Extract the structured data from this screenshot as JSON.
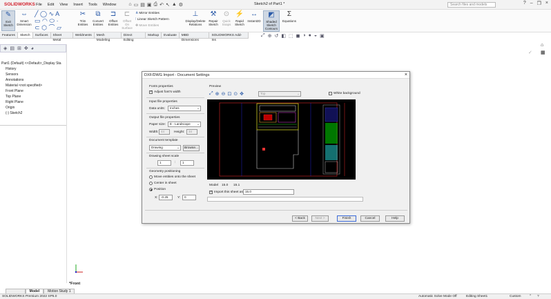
{
  "app": {
    "logo": "SOLIDWORKS",
    "title": "Sketch2 of Part1 *",
    "search_placeholder": "Search files and models"
  },
  "menu": [
    "File",
    "Edit",
    "View",
    "Insert",
    "Tools",
    "Window"
  ],
  "ribbon": {
    "exit_sketch": "Exit Sketch",
    "smart_dimension": "Smart Dimension",
    "trim": "Trim Entities",
    "convert": "Convert Entities",
    "offset": "Offset Entities",
    "offset_surface": "Offset On Surface",
    "mirror": "Mirror Entities",
    "linear_pattern": "Linear Sketch Pattern",
    "move": "Move Entities",
    "display_delete": "Display/Delete Relations",
    "repair": "Repair Sketch",
    "quick_snaps": "Quick Snaps",
    "rapid_sketch": "Rapid Sketch",
    "instant2d": "Instant2D",
    "shaded_contours": "Shaded Sketch Contours",
    "equations": "Equations"
  },
  "tabs": [
    "Features",
    "Sketch",
    "Surfaces",
    "Sheet Metal",
    "Weldments",
    "Mesh Modeling",
    "Direct Editing",
    "Markup",
    "Evaluate",
    "MBD Dimensions",
    "SOLIDWORKS Add-Ins"
  ],
  "tree": {
    "root": "Part1 (Default) <<Default>_Display Sta",
    "items": [
      "History",
      "Sensors",
      "Annotations",
      "Material <not specified>",
      "Front Plane",
      "Top Plane",
      "Right Plane",
      "Origin",
      "(-) Sketch2"
    ]
  },
  "dialog": {
    "title": "DXF/DWG Import - Document Settings",
    "fonts_group": "Fonts properties",
    "adjust_font": "Adjust font's width",
    "input_group": "Input file properties",
    "data_units_label": "Data units:",
    "data_units_value": "Inches",
    "output_group": "Output file properties",
    "paper_size_label": "Paper size:",
    "paper_size_value": "E - Landscape",
    "width_label": "Width:",
    "width_value": "44",
    "height_label": "Height:",
    "height_value": "34",
    "template_group": "Document template",
    "template_value": "Drawing",
    "browse": "Browse...",
    "scale_group": "Drawing sheet scale",
    "scale_left": "1",
    "scale_sep": ":",
    "scale_right": "1",
    "geometry_group": "Geometry positioning",
    "move_entities": "Move entities onto the sheet",
    "center_sheet": "Center in sheet",
    "position": "Position",
    "x_label": "X:",
    "x_value": "-0.25",
    "y_label": "Y:",
    "y_value": "0",
    "preview_group": "Preview",
    "view_select": "Top",
    "white_bg": "White background",
    "model_label": "Model",
    "model_a": "15.0",
    "model_b": "15.1",
    "import_sheet": "Import this sheet as",
    "import_value": "15.0",
    "back": "< Back",
    "next": "Next >",
    "finish": "Finish",
    "cancel": "Cancel",
    "help": "Help"
  },
  "footer_tabs": [
    "",
    "Model",
    "Motion Study 1"
  ],
  "view_label": "*Front",
  "status": {
    "version": "SOLIDWORKS Premium 2022 SP5.0",
    "solve": "Automatic Solve Mode Off",
    "editing": "Editing Sheet1",
    "units": "Custom"
  },
  "colors": {
    "brand": "#d21f2b",
    "canvas": "#000000",
    "accent": "#3b6ad8"
  }
}
